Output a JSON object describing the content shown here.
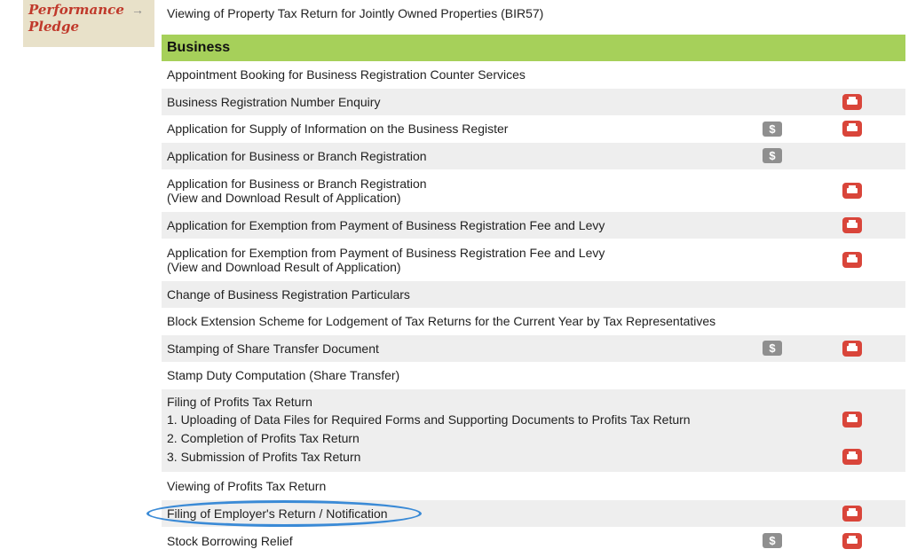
{
  "pledge": {
    "line1": "Performance",
    "line2": "Pledge",
    "arrow": "→"
  },
  "top_item": "Viewing of Property Tax Return for Jointly Owned Properties (BIR57)",
  "section": {
    "title": "Business"
  },
  "rows": [
    {
      "label": "Appointment Booking for Business Registration Counter Services",
      "fee": false,
      "ppt": false
    },
    {
      "label": "Business Registration Number Enquiry",
      "fee": false,
      "ppt": true
    },
    {
      "label": "Application for Supply of Information on the Business Register",
      "fee": true,
      "ppt": true
    },
    {
      "label": "Application for Business or Branch Registration",
      "fee": true,
      "ppt": false
    },
    {
      "label": "Application for Business or Branch Registration",
      "sub": "(View and Download Result of Application)",
      "fee": false,
      "ppt": true
    },
    {
      "label": "Application for Exemption from Payment of Business Registration Fee and Levy",
      "fee": false,
      "ppt": true
    },
    {
      "label": "Application for Exemption from Payment of Business Registration Fee and Levy",
      "sub": "(View and Download Result of Application)",
      "fee": false,
      "ppt": true
    },
    {
      "label": "Change of Business Registration Particulars",
      "fee": false,
      "ppt": false
    },
    {
      "label": "Block Extension Scheme for Lodgement of Tax Returns for the Current Year by Tax Representatives",
      "fee": false,
      "ppt": false
    },
    {
      "label": "Stamping of Share Transfer Document",
      "fee": true,
      "ppt": true
    },
    {
      "label": "Stamp Duty Computation (Share Transfer)",
      "fee": false,
      "ppt": false
    }
  ],
  "profits_tax": {
    "label": "Filing of Profits Tax Return",
    "steps": [
      {
        "num": "1.",
        "text": "Uploading of Data Files for Required Forms and Supporting Documents to Profits Tax Return",
        "ppt": true
      },
      {
        "num": "2.",
        "text": "Completion of Profits Tax Return",
        "ppt": false
      },
      {
        "num": "3.",
        "text": "Submission of Profits Tax Return",
        "ppt": true
      }
    ]
  },
  "tail_rows": [
    {
      "label": "Viewing of Profits Tax Return",
      "fee": false,
      "ppt": false
    },
    {
      "label": "Filing of Employer's Return / Notification",
      "fee": false,
      "ppt": true
    },
    {
      "label": "Stock Borrowing Relief",
      "fee": true,
      "ppt": true
    }
  ],
  "icons": {
    "fee_symbol": "$"
  },
  "colors": {
    "section_header": "#a6d05a",
    "ppt_icon": "#d9453a",
    "highlight": "#3a8ad6"
  }
}
